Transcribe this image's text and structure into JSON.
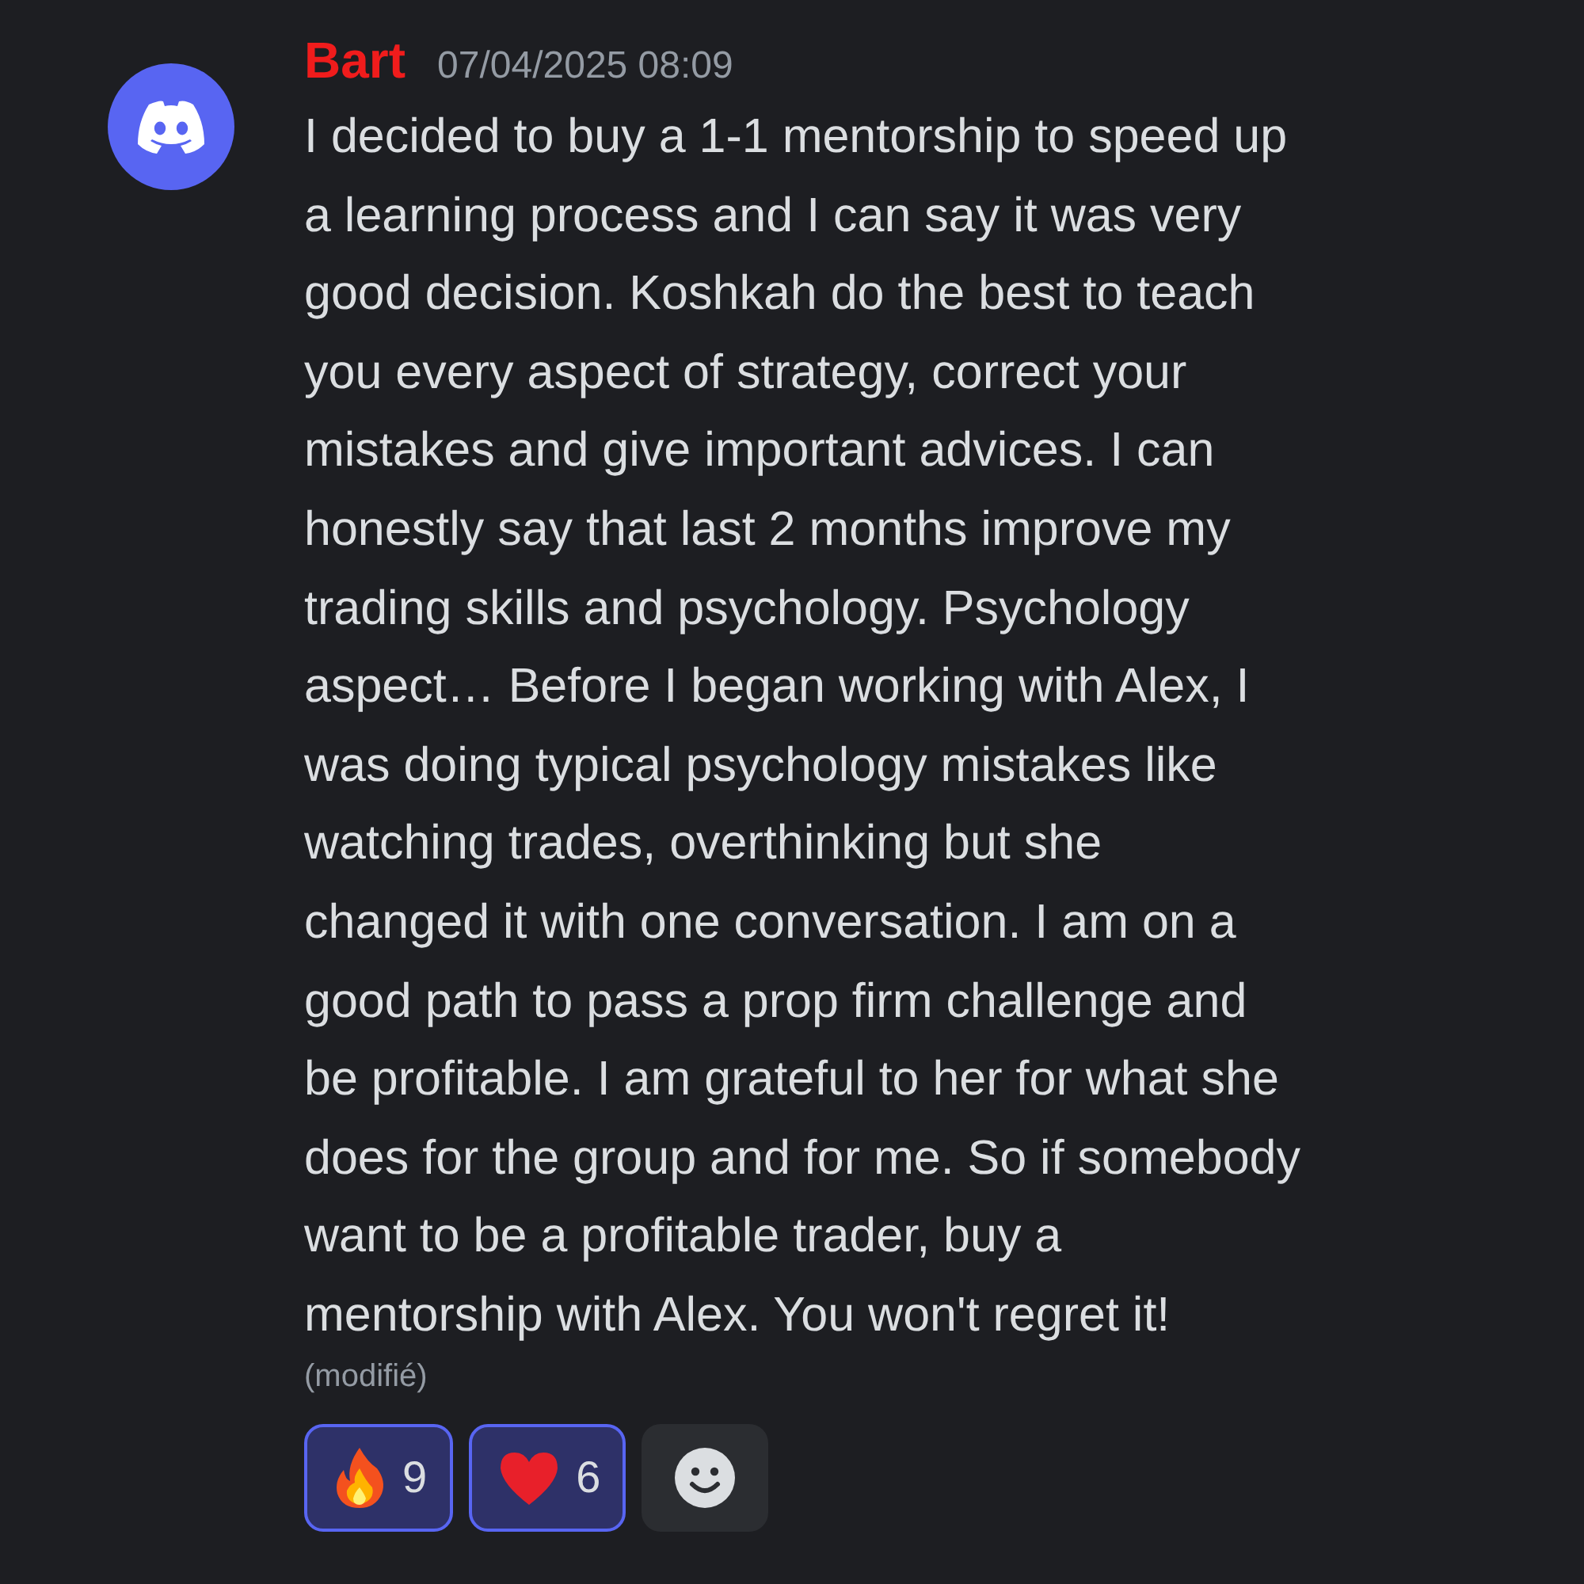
{
  "message": {
    "author": "Bart",
    "timestamp": "07/04/2025 08:09",
    "lines": [
      "I decided to buy a 1-1 mentorship to speed up",
      "a learning process and I can say it was very",
      "good decision. Koshkah do the best to teach",
      "you every aspect of strategy, correct your",
      "mistakes and give important advices. I can",
      "honestly say that last 2 months improve my",
      "trading skills and psychology. Psychology",
      "aspect… Before I began working with Alex, I",
      "was doing typical psychology mistakes like",
      "watching trades, overthinking but she",
      "changed it with one conversation. I am on a",
      "good path to pass a prop firm challenge and",
      "be profitable. I am grateful to her for what she",
      "does for the group and for me. So if somebody",
      "want to be a profitable trader, buy a",
      "mentorship with Alex. You won't regret it!"
    ],
    "edited_label": "(modifié)"
  },
  "reactions": [
    {
      "kind": "fire",
      "count": "9",
      "selected": true
    },
    {
      "kind": "heart",
      "count": "6",
      "selected": true
    }
  ]
}
